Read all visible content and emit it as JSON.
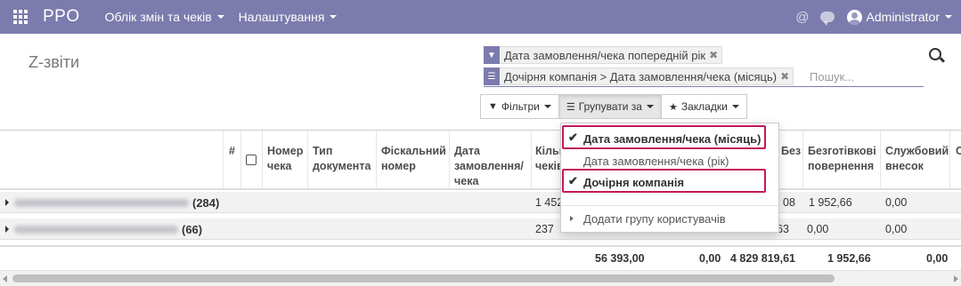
{
  "navbar": {
    "brand": "PPO",
    "menus": [
      {
        "label": "Облік змін та чеків"
      },
      {
        "label": "Налаштування"
      }
    ],
    "user": "Administrator"
  },
  "page": {
    "title": "Z-звіти"
  },
  "search": {
    "facets": [
      {
        "icon": "filter-icon",
        "text": "Дата замовлення/чека попередній рік"
      },
      {
        "icon": "group-by-icon",
        "text": "Дочірня компанія > Дата замовлення/чека (місяць)"
      }
    ],
    "placeholder": "Пошук..."
  },
  "toolbar": {
    "filters_label": "Фільтри",
    "groupby_label": "Групувати за",
    "favorites_label": "Закладки"
  },
  "table": {
    "columns": [
      "#",
      "Номер чека",
      "Тип документа",
      "Фіскальний номер",
      "Дата замовлення/ чека",
      "Кількість чеків",
      "Безготівкові",
      "Безготівкові повернення",
      "Службовий внесок",
      "С"
    ],
    "col_number": "#",
    "col_check": "Номер чека",
    "col_doctype": "Тип документа",
    "col_fiscal": "Фіскальний номер",
    "col_date": "Дата замовлення/ чека",
    "col_count": "Кількість чеків",
    "col_noncash": "Безготівкові",
    "col_noncash_return": "Безготівкові повернення",
    "col_service": "Службовий внесок",
    "col_last": "С",
    "groups": [
      {
        "count": "(284)",
        "cells": {
          "count_val": "1 452",
          "noncash": "08",
          "noncash_return": "1 952,66",
          "service": "0,00"
        }
      },
      {
        "count": "(66)",
        "cells": {
          "count_val": "237",
          "noncash": "63",
          "noncash_return": "0,00",
          "service": "0,00"
        }
      }
    ],
    "totals": {
      "a": "56 393,00",
      "b": "0,00",
      "c": "4 829 819,61",
      "d": "1 952,66",
      "e": "0,00"
    }
  },
  "groupby_menu": {
    "items": [
      {
        "label": "Дата замовлення/чека (місяць)",
        "checked": true
      },
      {
        "label": "Дата замовлення/чека (рік)",
        "checked": false
      },
      {
        "label": "Дочірня компанія",
        "checked": true
      }
    ],
    "add_custom": "Додати групу користувачів"
  },
  "colors": {
    "brand": "#7c7bad",
    "highlight": "#c2185b"
  }
}
